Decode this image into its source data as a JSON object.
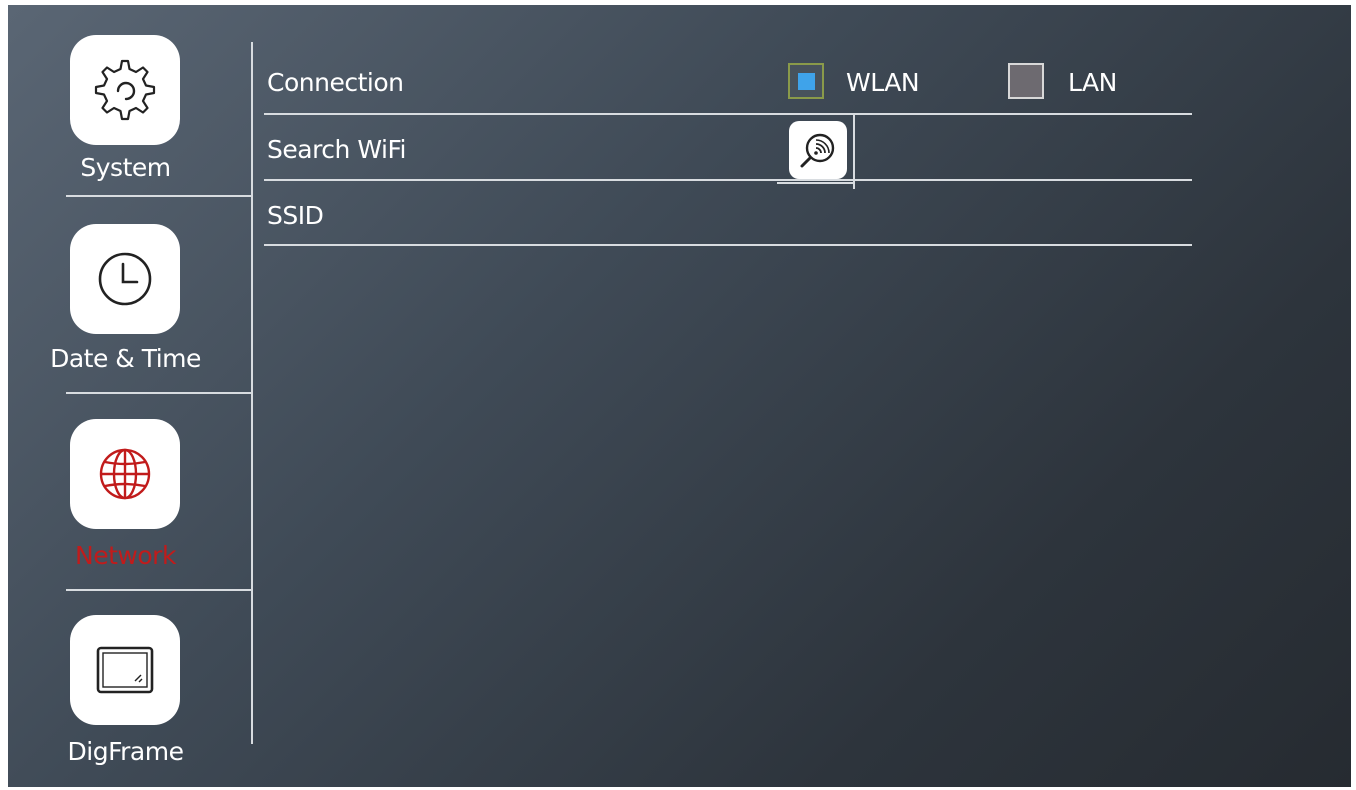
{
  "sidebar": {
    "items": [
      {
        "label": "System",
        "icon": "gear-icon",
        "active": false
      },
      {
        "label": "Date & Time",
        "icon": "clock-icon",
        "active": false
      },
      {
        "label": "Network",
        "icon": "globe-icon",
        "active": true
      },
      {
        "label": "DigFrame",
        "icon": "photo-frame-icon",
        "active": false
      }
    ]
  },
  "network": {
    "connection_label": "Connection",
    "options": [
      {
        "label": "WLAN",
        "checked": true
      },
      {
        "label": "LAN",
        "checked": false
      }
    ],
    "search_wifi_label": "Search WiFi",
    "search_icon": "wifi-search-icon",
    "ssid_label": "SSID",
    "ssid_value": ""
  },
  "colors": {
    "active": "#c11b1b",
    "checked_fill": "#3fa3ea",
    "text": "#ffffff"
  }
}
